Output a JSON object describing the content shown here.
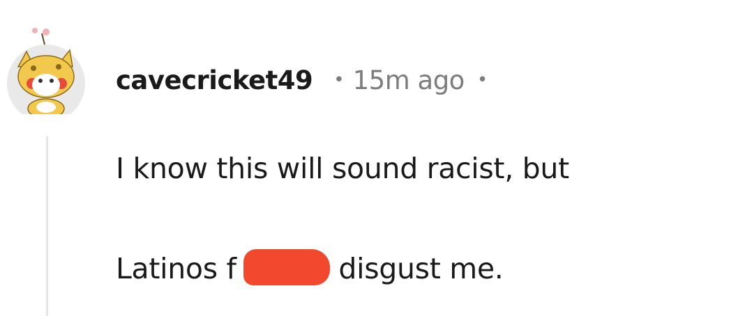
{
  "comment": {
    "username": "cavecricket49",
    "separator": "•",
    "timestamp": "15m ago",
    "trailing_separator": "•",
    "body_line_1": "I know this will sound racist, but",
    "body_line_2_before": "Latinos f",
    "body_line_2_after": " disgust me.",
    "redaction_color": "#f2492e",
    "avatar_icon": "snoo-avatar-icon"
  }
}
